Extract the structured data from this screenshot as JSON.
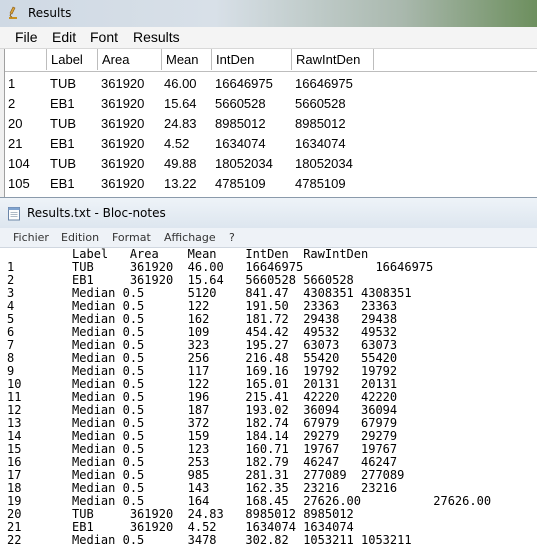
{
  "results_window": {
    "title": "Results",
    "menu": [
      "File",
      "Edit",
      "Font",
      "Results"
    ],
    "columns": [
      "",
      "Label",
      "Area",
      "Mean",
      "IntDen",
      "RawIntDen"
    ],
    "rows": [
      [
        "1",
        "TUB",
        "361920",
        "46.00",
        "16646975",
        "16646975"
      ],
      [
        "2",
        "EB1",
        "361920",
        "15.64",
        "5660528",
        "5660528"
      ],
      [
        "20",
        "TUB",
        "361920",
        "24.83",
        "8985012",
        "8985012"
      ],
      [
        "21",
        "EB1",
        "361920",
        "4.52",
        "1634074",
        "1634074"
      ],
      [
        "104",
        "TUB",
        "361920",
        "49.88",
        "18052034",
        "18052034"
      ],
      [
        "105",
        "EB1",
        "361920",
        "13.22",
        "4785109",
        "4785109"
      ]
    ]
  },
  "notepad": {
    "title": "Results.txt - Bloc-notes",
    "menu": [
      "Fichier",
      "Edition",
      "Format",
      "Affichage",
      "?"
    ],
    "lines": [
      "         Label   Area    Mean    IntDen  RawIntDen",
      "1        TUB     361920  46.00   16646975          16646975",
      "2        EB1     361920  15.64   5660528 5660528",
      "3        Median 0.5      5120    841.47  4308351 4308351",
      "4        Median 0.5      122     191.50  23363   23363",
      "5        Median 0.5      162     181.72  29438   29438",
      "6        Median 0.5      109     454.42  49532   49532",
      "7        Median 0.5      323     195.27  63073   63073",
      "8        Median 0.5      256     216.48  55420   55420",
      "9        Median 0.5      117     169.16  19792   19792",
      "10       Median 0.5      122     165.01  20131   20131",
      "11       Median 0.5      196     215.41  42220   42220",
      "12       Median 0.5      187     193.02  36094   36094",
      "13       Median 0.5      372     182.74  67979   67979",
      "14       Median 0.5      159     184.14  29279   29279",
      "15       Median 0.5      123     160.71  19767   19767",
      "16       Median 0.5      253     182.79  46247   46247",
      "17       Median 0.5      985     281.31  277089  277089",
      "18       Median 0.5      143     162.35  23216   23216",
      "19       Median 0.5      164     168.45  27626.00          27626.00",
      "20       TUB     361920  24.83   8985012 8985012",
      "21       EB1     361920  4.52    1634074 1634074",
      "22       Median 0.5      3478    302.82  1053211 1053211"
    ]
  }
}
